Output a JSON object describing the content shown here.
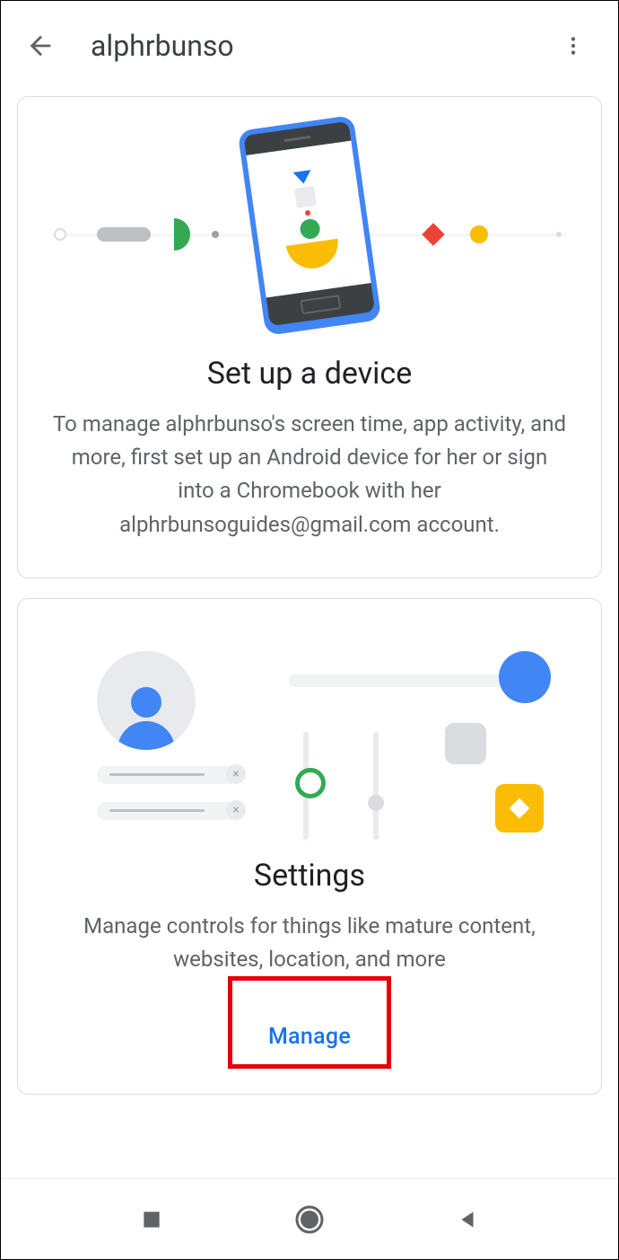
{
  "header": {
    "title": "alphrbunso"
  },
  "cards": {
    "setup": {
      "title": "Set up a device",
      "description": "To manage alphrbunso's screen time, app activity, and more, first set up an Android device for her or sign into a Chromebook with her alphrbunsoguides@gmail.com account."
    },
    "settings": {
      "title": "Settings",
      "description": "Manage controls for things like mature content, websites, location, and more",
      "button": "Manage"
    }
  }
}
